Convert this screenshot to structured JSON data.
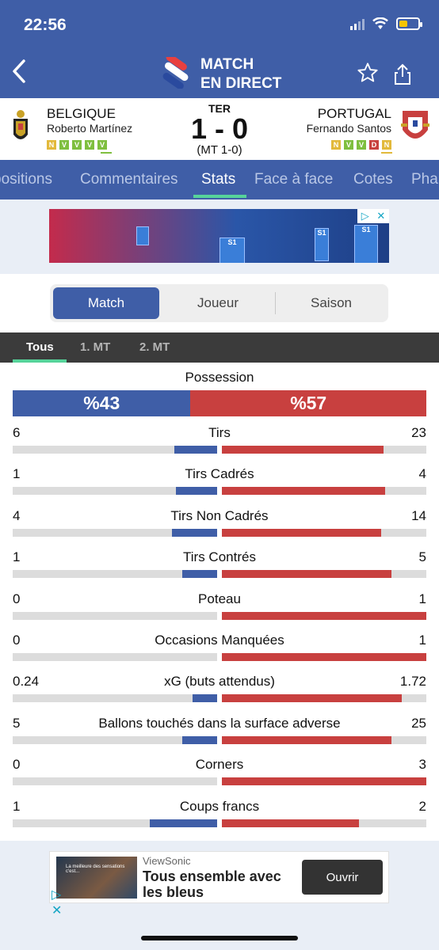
{
  "status_bar": {
    "time": "22:56"
  },
  "header": {
    "title_line1": "MATCH",
    "title_line2": "EN DIRECT"
  },
  "match": {
    "status": "TER",
    "score": "1 - 0",
    "halftime": "(MT 1-0)",
    "home": {
      "name": "BELGIQUE",
      "coach": "Roberto Martínez",
      "form": [
        "N",
        "V",
        "V",
        "V",
        "V"
      ]
    },
    "away": {
      "name": "PORTUGAL",
      "coach": "Fernando Santos",
      "form": [
        "N",
        "V",
        "V",
        "D",
        "N"
      ]
    }
  },
  "colors": {
    "header": "#3f5ea7",
    "home": "#3f5ea7",
    "away": "#c8403f",
    "accent": "#56d39a",
    "form_win": "#7fbf3f",
    "form_draw": "#e2b93b",
    "form_loss": "#c8403f"
  },
  "tabs": [
    "positions",
    "Commentaires",
    "Stats",
    "Face à face",
    "Cotes",
    "Pha"
  ],
  "active_tab": "Stats",
  "segmented": {
    "options": [
      "Match",
      "Joueur",
      "Saison"
    ],
    "selected": "Match"
  },
  "periods": {
    "options": [
      "Tous",
      "1. MT",
      "2. MT"
    ],
    "selected": "Tous"
  },
  "possession": {
    "label": "Possession",
    "home": "%43",
    "away": "%57",
    "home_pct": 43,
    "away_pct": 57
  },
  "stats": [
    {
      "label": "Tirs",
      "home": "6",
      "away": "23",
      "home_fill": 0.21,
      "away_fill": 0.79
    },
    {
      "label": "Tirs Cadrés",
      "home": "1",
      "away": "4",
      "home_fill": 0.2,
      "away_fill": 0.8
    },
    {
      "label": "Tirs Non Cadrés",
      "home": "4",
      "away": "14",
      "home_fill": 0.22,
      "away_fill": 0.78
    },
    {
      "label": "Tirs Contrés",
      "home": "1",
      "away": "5",
      "home_fill": 0.17,
      "away_fill": 0.83
    },
    {
      "label": "Poteau",
      "home": "0",
      "away": "1",
      "home_fill": 0,
      "away_fill": 1
    },
    {
      "label": "Occasions Manquées",
      "home": "0",
      "away": "1",
      "home_fill": 0,
      "away_fill": 1
    },
    {
      "label": "xG (buts attendus)",
      "home": "0.24",
      "away": "1.72",
      "home_fill": 0.12,
      "away_fill": 0.88
    },
    {
      "label": "Ballons touchés dans la surface adverse",
      "home": "5",
      "away": "25",
      "home_fill": 0.17,
      "away_fill": 0.83
    },
    {
      "label": "Corners",
      "home": "0",
      "away": "3",
      "home_fill": 0,
      "away_fill": 1
    },
    {
      "label": "Coups francs",
      "home": "1",
      "away": "2",
      "home_fill": 0.33,
      "away_fill": 0.67
    }
  ],
  "ads": {
    "top_banner": {
      "cards": [
        "S1",
        "S1",
        "S1"
      ]
    },
    "bottom": {
      "thumb_text": "La meilleure des sensations c'est...",
      "brand": "ViewSonic",
      "headline": "Tous ensemble avec les bleus",
      "cta": "Ouvrir"
    }
  }
}
